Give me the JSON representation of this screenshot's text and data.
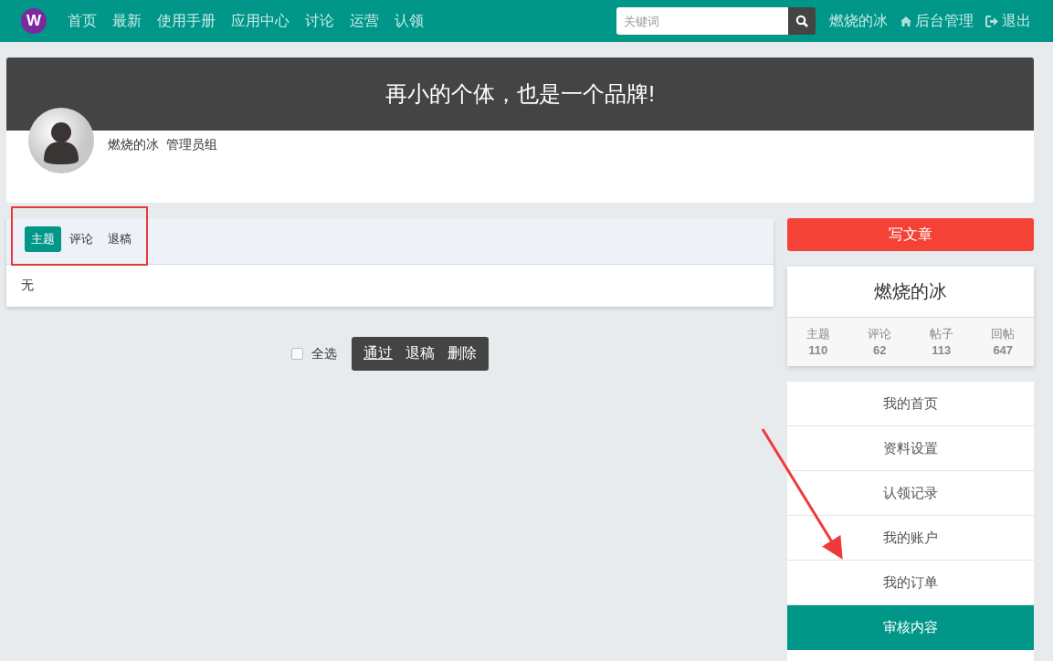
{
  "brand": {
    "logo_letter": "W"
  },
  "nav": [
    "首页",
    "最新",
    "使用手册",
    "应用中心",
    "讨论",
    "运营",
    "认领"
  ],
  "search": {
    "placeholder": "关键词"
  },
  "user_links": [
    {
      "kind": "user",
      "label": "燃烧的冰"
    },
    {
      "kind": "home",
      "label": "后台管理"
    },
    {
      "kind": "logout",
      "label": "退出"
    }
  ],
  "banner": {
    "slogan": "再小的个体，也是一个品牌!",
    "username": "燃烧的冰",
    "group": "管理员组"
  },
  "tabs": [
    {
      "label": "主题",
      "selected": true
    },
    {
      "label": "评论",
      "selected": false
    },
    {
      "label": "退稿",
      "selected": false
    }
  ],
  "list": {
    "empty_text": "无"
  },
  "bulk": {
    "select_all": {
      "label": "全选",
      "checked": false
    },
    "buttons": [
      {
        "label": "通过",
        "underlined": true
      },
      {
        "label": "退稿",
        "underlined": false
      },
      {
        "label": "删除",
        "underlined": false
      }
    ]
  },
  "sidebar": {
    "write_button": "写文章",
    "profile": {
      "name": "燃烧的冰",
      "stats": [
        {
          "label": "主题",
          "value": "110"
        },
        {
          "label": "评论",
          "value": "62"
        },
        {
          "label": "帖子",
          "value": "113"
        },
        {
          "label": "回帖",
          "value": "647"
        }
      ]
    },
    "menu": [
      {
        "label": "我的首页",
        "selected": false
      },
      {
        "label": "资料设置",
        "selected": false
      },
      {
        "label": "认领记录",
        "selected": false
      },
      {
        "label": "我的账户",
        "selected": false
      },
      {
        "label": "我的订单",
        "selected": false
      },
      {
        "label": "审核内容",
        "selected": true
      }
    ]
  }
}
